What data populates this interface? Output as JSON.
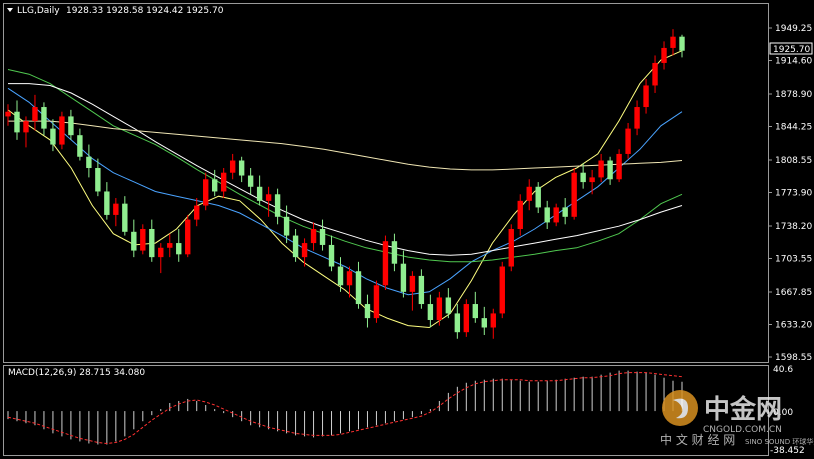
{
  "header": {
    "symbol_title": "LLG,Daily",
    "ohlc": "1928.33 1928.58 1924.42 1925.70"
  },
  "price_axis": {
    "ticks": [
      "1949.25",
      "1914.60",
      "1878.90",
      "1844.25",
      "1808.55",
      "1773.90",
      "1738.20",
      "1703.55",
      "1667.85",
      "1633.20",
      "1598.55"
    ],
    "current_price": "1925.70"
  },
  "macd": {
    "label": "MACD(12,26,9) 28.715 34.080",
    "axis_top": "40.6",
    "axis_zero": "0.00",
    "axis_bottom": "-38.452"
  },
  "watermark": {
    "brand": "中金网",
    "sub": "中 文 财 经 网",
    "site": "CNGOLD.COM.CN",
    "partner": "SINO SOUND 环球华兴"
  },
  "colors": {
    "background": "#000000",
    "bull": "#ff0000",
    "bear": "#90ee90",
    "ma_fast": "#ffff80",
    "ma_blue": "#4aa3ff",
    "ma_green": "#50c850",
    "ma_white": "#ffffff",
    "ma_slow": "#f0e6b4",
    "macd_signal": "#ff3030"
  },
  "chart_data": {
    "type": "candlestick",
    "period": "Daily",
    "y_range": [
      1598.55,
      1949.25
    ],
    "ma_values": {
      "fast": [
        1862,
        1845,
        1830,
        1800,
        1760,
        1730,
        1718,
        1720,
        1735,
        1760,
        1770,
        1765,
        1745,
        1720,
        1700,
        1685,
        1670,
        1650,
        1640,
        1632,
        1630,
        1645,
        1680,
        1720,
        1750,
        1775,
        1790,
        1800,
        1815,
        1850,
        1890,
        1915,
        1925
      ],
      "blue": [
        1885,
        1870,
        1850,
        1830,
        1810,
        1795,
        1785,
        1775,
        1770,
        1765,
        1760,
        1752,
        1740,
        1728,
        1715,
        1705,
        1695,
        1682,
        1672,
        1665,
        1668,
        1682,
        1700,
        1712,
        1722,
        1735,
        1750,
        1765,
        1780,
        1800,
        1820,
        1845,
        1860
      ],
      "green": [
        1905,
        1900,
        1890,
        1875,
        1860,
        1845,
        1835,
        1825,
        1812,
        1798,
        1785,
        1772,
        1760,
        1748,
        1738,
        1730,
        1722,
        1715,
        1710,
        1705,
        1702,
        1700,
        1700,
        1702,
        1705,
        1708,
        1712,
        1715,
        1722,
        1730,
        1745,
        1762,
        1772
      ],
      "white": [
        1890,
        1890,
        1888,
        1880,
        1868,
        1855,
        1842,
        1828,
        1815,
        1802,
        1790,
        1778,
        1766,
        1755,
        1745,
        1737,
        1730,
        1723,
        1717,
        1712,
        1708,
        1707,
        1708,
        1712,
        1716,
        1720,
        1724,
        1728,
        1733,
        1738,
        1745,
        1753,
        1760
      ],
      "slow": [
        1850,
        1850,
        1850,
        1848,
        1845,
        1842,
        1840,
        1838,
        1836,
        1834,
        1832,
        1830,
        1828,
        1826,
        1823,
        1820,
        1816,
        1812,
        1808,
        1804,
        1801,
        1799,
        1798,
        1798,
        1799,
        1800,
        1801,
        1802,
        1803,
        1804,
        1805,
        1806,
        1808
      ]
    },
    "candles": [
      [
        1855,
        1868,
        1845,
        1860
      ],
      [
        1860,
        1872,
        1830,
        1838
      ],
      [
        1838,
        1855,
        1822,
        1850
      ],
      [
        1850,
        1878,
        1840,
        1865
      ],
      [
        1865,
        1870,
        1835,
        1842
      ],
      [
        1842,
        1852,
        1818,
        1825
      ],
      [
        1825,
        1860,
        1820,
        1855
      ],
      [
        1855,
        1862,
        1830,
        1835
      ],
      [
        1835,
        1842,
        1808,
        1812
      ],
      [
        1812,
        1825,
        1790,
        1800
      ],
      [
        1800,
        1810,
        1770,
        1775
      ],
      [
        1775,
        1785,
        1745,
        1750
      ],
      [
        1750,
        1768,
        1738,
        1762
      ],
      [
        1762,
        1770,
        1728,
        1732
      ],
      [
        1732,
        1745,
        1705,
        1712
      ],
      [
        1712,
        1740,
        1708,
        1735
      ],
      [
        1735,
        1745,
        1700,
        1705
      ],
      [
        1705,
        1720,
        1688,
        1715
      ],
      [
        1715,
        1730,
        1705,
        1720
      ],
      [
        1720,
        1735,
        1700,
        1708
      ],
      [
        1708,
        1750,
        1705,
        1745
      ],
      [
        1745,
        1768,
        1738,
        1760
      ],
      [
        1760,
        1795,
        1755,
        1788
      ],
      [
        1788,
        1798,
        1770,
        1775
      ],
      [
        1775,
        1800,
        1768,
        1795
      ],
      [
        1795,
        1815,
        1788,
        1808
      ],
      [
        1808,
        1812,
        1785,
        1792
      ],
      [
        1792,
        1800,
        1772,
        1780
      ],
      [
        1780,
        1792,
        1760,
        1765
      ],
      [
        1765,
        1780,
        1748,
        1772
      ],
      [
        1772,
        1778,
        1740,
        1748
      ],
      [
        1748,
        1760,
        1720,
        1728
      ],
      [
        1728,
        1735,
        1700,
        1705
      ],
      [
        1705,
        1725,
        1695,
        1720
      ],
      [
        1720,
        1742,
        1712,
        1735
      ],
      [
        1735,
        1745,
        1712,
        1718
      ],
      [
        1718,
        1728,
        1690,
        1695
      ],
      [
        1695,
        1705,
        1668,
        1675
      ],
      [
        1675,
        1695,
        1662,
        1690
      ],
      [
        1690,
        1700,
        1650,
        1655
      ],
      [
        1655,
        1665,
        1630,
        1640
      ],
      [
        1640,
        1680,
        1635,
        1675
      ],
      [
        1675,
        1728,
        1670,
        1722
      ],
      [
        1722,
        1730,
        1690,
        1698
      ],
      [
        1698,
        1712,
        1662,
        1668
      ],
      [
        1668,
        1690,
        1648,
        1685
      ],
      [
        1685,
        1692,
        1650,
        1655
      ],
      [
        1655,
        1665,
        1630,
        1638
      ],
      [
        1638,
        1668,
        1632,
        1662
      ],
      [
        1662,
        1672,
        1640,
        1645
      ],
      [
        1645,
        1655,
        1618,
        1625
      ],
      [
        1625,
        1660,
        1620,
        1655
      ],
      [
        1655,
        1668,
        1635,
        1640
      ],
      [
        1640,
        1652,
        1622,
        1630
      ],
      [
        1630,
        1650,
        1618,
        1645
      ],
      [
        1645,
        1700,
        1640,
        1695
      ],
      [
        1695,
        1740,
        1690,
        1735
      ],
      [
        1735,
        1772,
        1728,
        1765
      ],
      [
        1765,
        1788,
        1755,
        1780
      ],
      [
        1780,
        1785,
        1752,
        1758
      ],
      [
        1758,
        1765,
        1735,
        1742
      ],
      [
        1742,
        1762,
        1738,
        1758
      ],
      [
        1758,
        1768,
        1740,
        1748
      ],
      [
        1748,
        1800,
        1745,
        1795
      ],
      [
        1795,
        1805,
        1778,
        1785
      ],
      [
        1785,
        1798,
        1772,
        1790
      ],
      [
        1790,
        1815,
        1785,
        1808
      ],
      [
        1808,
        1812,
        1782,
        1788
      ],
      [
        1788,
        1820,
        1785,
        1815
      ],
      [
        1815,
        1848,
        1810,
        1842
      ],
      [
        1842,
        1872,
        1835,
        1865
      ],
      [
        1865,
        1895,
        1858,
        1888
      ],
      [
        1888,
        1920,
        1880,
        1912
      ],
      [
        1912,
        1935,
        1905,
        1928
      ],
      [
        1928,
        1948,
        1920,
        1940
      ],
      [
        1940,
        1942,
        1918,
        1925
      ]
    ],
    "macd_hist": [
      -8,
      -10,
      -12,
      -14,
      -18,
      -22,
      -25,
      -28,
      -30,
      -32,
      -33,
      -33,
      -30,
      -25,
      -18,
      -10,
      -4,
      2,
      8,
      10,
      12,
      10,
      6,
      2,
      -2,
      -6,
      -10,
      -14,
      -16,
      -18,
      -20,
      -22,
      -24,
      -25,
      -26,
      -25,
      -24,
      -22,
      -20,
      -18,
      -16,
      -14,
      -12,
      -10,
      -8,
      -6,
      -3,
      2,
      10,
      18,
      24,
      28,
      30,
      31,
      32,
      32,
      31,
      30,
      29,
      29,
      30,
      31,
      32,
      33,
      34,
      34,
      36,
      38,
      40,
      40,
      39,
      38,
      36,
      33,
      30,
      29
    ],
    "macd_signal": [
      -6,
      -8,
      -10,
      -12,
      -15,
      -18,
      -21,
      -24,
      -27,
      -29,
      -31,
      -32,
      -31,
      -28,
      -23,
      -16,
      -9,
      -3,
      3,
      7,
      10,
      11,
      9,
      6,
      2,
      -2,
      -6,
      -10,
      -13,
      -16,
      -18,
      -20,
      -22,
      -23,
      -24,
      -24,
      -24,
      -23,
      -21,
      -19,
      -17,
      -15,
      -13,
      -11,
      -9,
      -7,
      -5,
      -1,
      5,
      12,
      18,
      23,
      27,
      29,
      30,
      31,
      31,
      31,
      30,
      30,
      30,
      30,
      31,
      32,
      33,
      33,
      34,
      35,
      37,
      38,
      38,
      38,
      37,
      36,
      35,
      34
    ]
  }
}
